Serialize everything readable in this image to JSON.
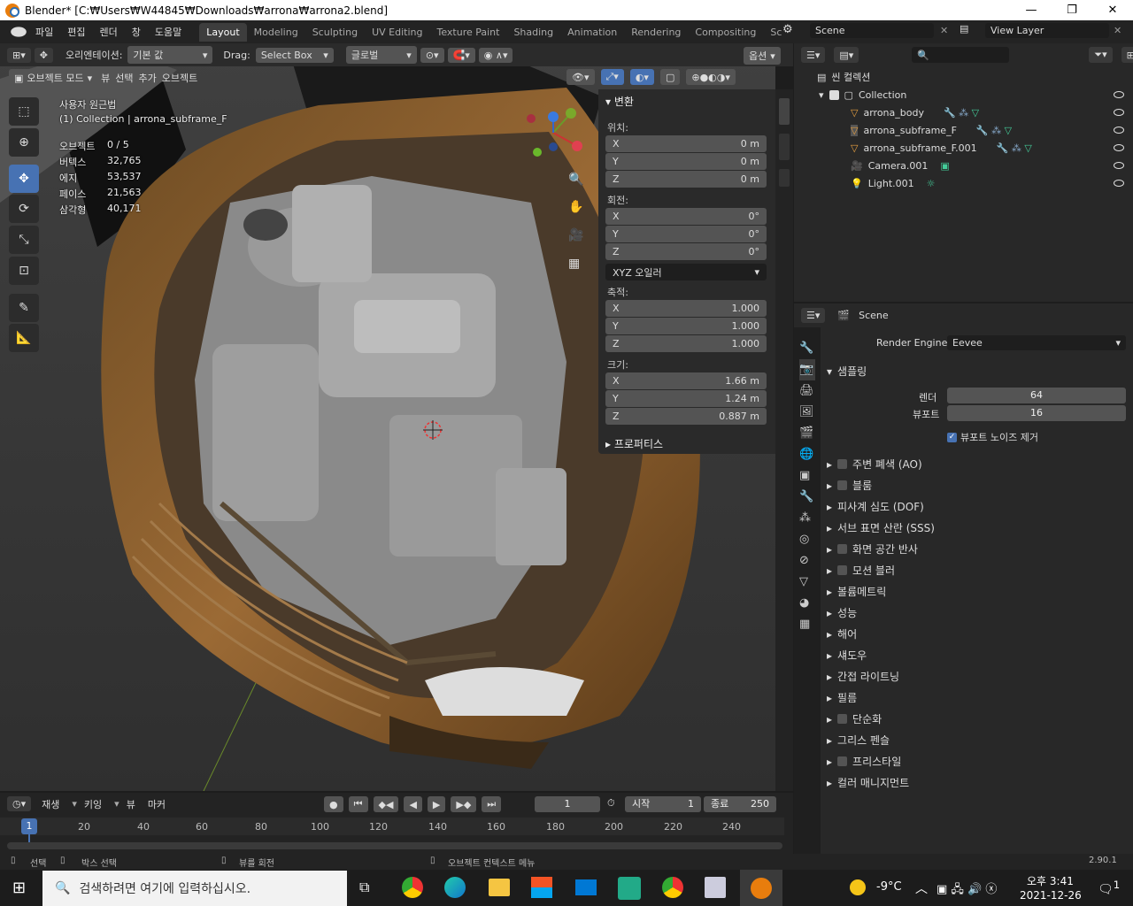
{
  "window": {
    "title": "Blender* [C:₩Users₩W44845₩Downloads₩arrona₩arrona2.blend]"
  },
  "menus": [
    "파일",
    "편집",
    "렌더",
    "창",
    "도움말"
  ],
  "workspaces": [
    "Layout",
    "Modeling",
    "Sculpting",
    "UV Editing",
    "Texture Paint",
    "Shading",
    "Animation",
    "Rendering",
    "Compositing",
    "Sc"
  ],
  "scene": "Scene",
  "view_layer": "View Layer",
  "vp_header": {
    "orientation_label": "오리엔테이션:",
    "orientation": "기본 값",
    "drag_label": "Drag:",
    "drag": "Select Box",
    "transform": "글로벌",
    "options": "옵션"
  },
  "vp_header2": {
    "mode": "오브젝트 모드",
    "view": "뷰",
    "select": "선택",
    "add": "추가",
    "object": "오브젝트"
  },
  "overlay": {
    "view_name": "사용자 원근법",
    "collection": "(1) Collection | arrona_subframe_F",
    "stats": [
      {
        "k": "오브젝트",
        "v": "0 / 5"
      },
      {
        "k": "버텍스",
        "v": "32,765"
      },
      {
        "k": "에지",
        "v": "53,537"
      },
      {
        "k": "페이스",
        "v": "21,563"
      },
      {
        "k": "삼각형",
        "v": "40,171"
      }
    ]
  },
  "npanel": {
    "header": "변환",
    "location_label": "위치:",
    "loc": [
      "0 m",
      "0 m",
      "0 m"
    ],
    "rotation_label": "회전:",
    "rot": [
      "0°",
      "0°",
      "0°"
    ],
    "rot_mode": "XYZ 오일러",
    "scale_label": "축적:",
    "scale": [
      "1.000",
      "1.000",
      "1.000"
    ],
    "dim_label": "크기:",
    "dim": [
      "1.66 m",
      "1.24 m",
      "0.887 m"
    ],
    "props_label": "프로퍼티스",
    "axes": [
      "X",
      "Y",
      "Z"
    ]
  },
  "outliner": {
    "root": "씬 컬렉션",
    "collection": "Collection",
    "items": [
      "arrona_body",
      "arrona_subframe_F",
      "arrona_subframe_F.001",
      "Camera.001",
      "Light.001"
    ]
  },
  "properties": {
    "scene": "Scene",
    "render_engine_label": "Render Engine",
    "render_engine": "Eevee",
    "sampling": "샘플링",
    "render_label": "렌더",
    "render_val": "64",
    "viewport_label": "뷰포트",
    "viewport_val": "16",
    "denoise": "뷰포트 노이즈 제거",
    "sections": [
      "주변 폐색 (AO)",
      "블룸",
      "피사계 심도 (DOF)",
      "서브 표면 산란 (SSS)",
      "화면 공간 반사",
      "모션 블러",
      "볼륨메트릭",
      "성능",
      "해어",
      "섀도우",
      "간접 라이트닝",
      "필름",
      "단순화",
      "그리스 펜슬",
      "프리스타일",
      "컬러 매니지먼트"
    ]
  },
  "timeline": {
    "playback": "재생",
    "keying": "키잉",
    "view": "뷰",
    "marker": "마커",
    "current": "1",
    "start_label": "시작",
    "start": "1",
    "end_label": "종료",
    "end": "250",
    "ticks": [
      "1",
      "20",
      "40",
      "60",
      "80",
      "100",
      "120",
      "140",
      "160",
      "180",
      "200",
      "220",
      "240"
    ]
  },
  "status": {
    "select": "선택",
    "box_select": "박스 선택",
    "rotate_view": "뷰를 회전",
    "ctx_menu": "오브젝트 컨텍스트 메뉴",
    "version": "2.90.1"
  },
  "taskbar": {
    "search": "검색하려면 여기에 입력하십시오.",
    "temp": "-9°C",
    "time": "오후 3:41",
    "date": "2021-12-26",
    "notif": "1"
  }
}
